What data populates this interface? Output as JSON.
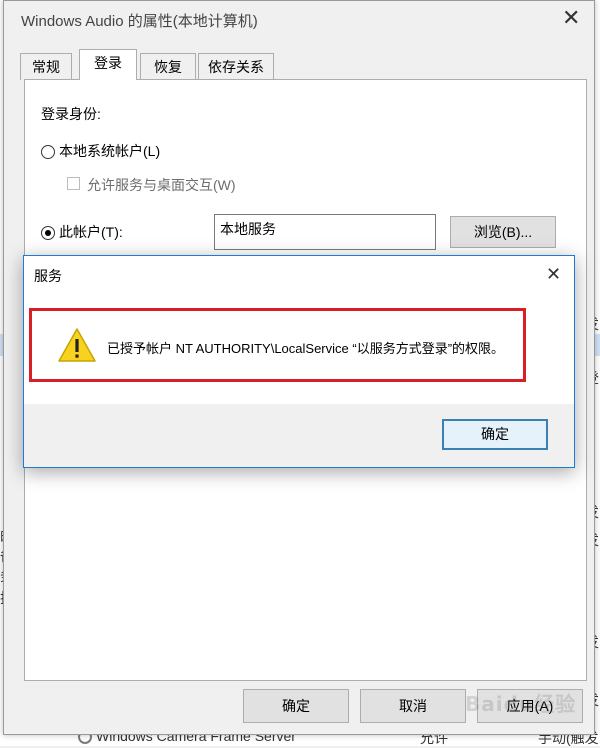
{
  "properties_dialog": {
    "title": "Windows Audio 的属性(本地计算机)",
    "tabs": [
      "常规",
      "登录",
      "恢复",
      "依存关系"
    ],
    "active_tab": "登录",
    "logon_as_label": "登录身份:",
    "local_system_label": "本地系统帐户(L)",
    "allow_desktop_label": "允许服务与桌面交互(W)",
    "this_account_label": "此帐户(T):",
    "account_value": "本地服务",
    "browse_button": "浏览(B)...",
    "ok_button": "确定",
    "cancel_button": "取消",
    "apply_button": "应用(A)"
  },
  "message_box": {
    "title": "服务",
    "message": "已授予帐户 NT AUTHORITY\\LocalService “以服务方式登录”的权限。",
    "ok_button": "确定",
    "icon": "warning-icon"
  },
  "background_list": {
    "left_fragments": [
      "的",
      "备",
      "务",
      "技"
    ],
    "right_fragments": [
      "发",
      "登",
      "发",
      "发",
      "发",
      "发"
    ],
    "bottom_row": {
      "name": "Windows Camera Frame Server",
      "status": "允许",
      "startup": "手动(触发"
    }
  },
  "watermark_text": "Baidu经验",
  "colors": {
    "accent": "#1e7bd4",
    "highlight_border": "#d91e26",
    "warning_yellow": "#f7d31f"
  }
}
